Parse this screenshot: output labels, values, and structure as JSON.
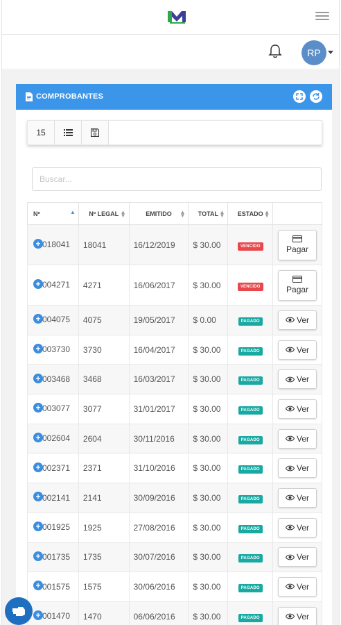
{
  "header": {
    "logo": "M",
    "menu_icon": "hamburger-icon"
  },
  "user": {
    "initials": "RP",
    "bell_icon": "bell-icon"
  },
  "card": {
    "title": "COMPROBANTES",
    "accent": "#3b95e9",
    "toolbar": {
      "page_size": "15",
      "list_icon": "list-icon",
      "save_icon": "save-icon"
    },
    "search_placeholder": "Buscar..."
  },
  "table": {
    "columns": [
      "Nº",
      "Nº LEGAL",
      "EMITIDO",
      "TOTAL",
      "ESTADO",
      ""
    ],
    "rows": [
      {
        "num": "018041",
        "legal": "18041",
        "date": "16/12/2019",
        "total": "$ 30.00",
        "status": "VENCIDO",
        "action": "Pagar"
      },
      {
        "num": "004271",
        "legal": "4271",
        "date": "16/06/2017",
        "total": "$ 30.00",
        "status": "VENCIDO",
        "action": "Pagar"
      },
      {
        "num": "004075",
        "legal": "4075",
        "date": "19/05/2017",
        "total": "$ 0.00",
        "status": "PAGADO",
        "action": "Ver"
      },
      {
        "num": "003730",
        "legal": "3730",
        "date": "16/04/2017",
        "total": "$ 30.00",
        "status": "PAGADO",
        "action": "Ver"
      },
      {
        "num": "003468",
        "legal": "3468",
        "date": "16/03/2017",
        "total": "$ 30.00",
        "status": "PAGADO",
        "action": "Ver"
      },
      {
        "num": "003077",
        "legal": "3077",
        "date": "31/01/2017",
        "total": "$ 30.00",
        "status": "PAGADO",
        "action": "Ver"
      },
      {
        "num": "002604",
        "legal": "2604",
        "date": "30/11/2016",
        "total": "$ 30.00",
        "status": "PAGADO",
        "action": "Ver"
      },
      {
        "num": "002371",
        "legal": "2371",
        "date": "31/10/2016",
        "total": "$ 30.00",
        "status": "PAGADO",
        "action": "Ver"
      },
      {
        "num": "002141",
        "legal": "2141",
        "date": "30/09/2016",
        "total": "$ 30.00",
        "status": "PAGADO",
        "action": "Ver"
      },
      {
        "num": "001925",
        "legal": "1925",
        "date": "27/08/2016",
        "total": "$ 30.00",
        "status": "PAGADO",
        "action": "Ver"
      },
      {
        "num": "001735",
        "legal": "1735",
        "date": "30/07/2016",
        "total": "$ 30.00",
        "status": "PAGADO",
        "action": "Ver"
      },
      {
        "num": "001575",
        "legal": "1575",
        "date": "30/06/2016",
        "total": "$ 30.00",
        "status": "PAGADO",
        "action": "Ver"
      },
      {
        "num": "001470",
        "legal": "1470",
        "date": "06/06/2016",
        "total": "$ 30.00",
        "status": "PAGADO",
        "action": "Ver"
      }
    ]
  },
  "colors": {
    "vencido": "#e8484b",
    "pagado": "#18a9a2",
    "fab": "#1f6fc1"
  },
  "fab_icon": "hand-icon"
}
